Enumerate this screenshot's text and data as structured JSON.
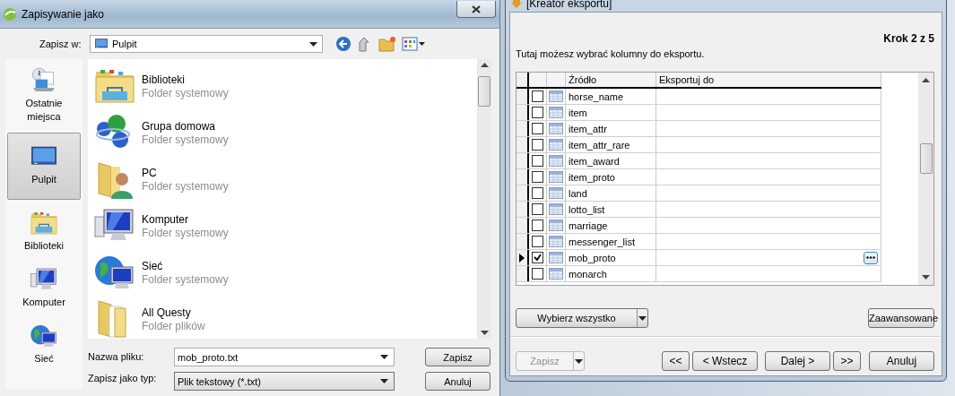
{
  "save_dialog": {
    "title": "Zapisywanie jako",
    "location_label": "Zapisz w:",
    "location": "Pulpit",
    "places": [
      {
        "label": "Ostatnie miejsca",
        "kind": "recent",
        "selected": false
      },
      {
        "label": "Pulpit",
        "kind": "desktop",
        "selected": true
      },
      {
        "label": "Biblioteki",
        "kind": "libraries",
        "selected": false
      },
      {
        "label": "Komputer",
        "kind": "computer",
        "selected": false
      },
      {
        "label": "Sieć",
        "kind": "network",
        "selected": false
      }
    ],
    "files": [
      {
        "name": "Biblioteki",
        "type": "Folder systemowy",
        "kind": "libraries"
      },
      {
        "name": "Grupa domowa",
        "type": "Folder systemowy",
        "kind": "homegroup"
      },
      {
        "name": "PC",
        "type": "Folder systemowy",
        "kind": "user"
      },
      {
        "name": "Komputer",
        "type": "Folder systemowy",
        "kind": "computer"
      },
      {
        "name": "Sieć",
        "type": "Folder systemowy",
        "kind": "network"
      },
      {
        "name": "All Questy",
        "type": "Folder plików",
        "kind": "folder"
      }
    ],
    "filename_label": "Nazwa pliku:",
    "filename": "mob_proto.txt",
    "filetype_label": "Zapisz jako typ:",
    "filetype": "Plik tekstowy (*.txt)",
    "buttons": [
      "Zapisz",
      "Anuluj"
    ]
  },
  "export_wizard": {
    "title": "[Kreator eksportu]",
    "step": "Krok 2 z 5",
    "description": "Tutaj możesz wybrać kolumny do eksportu.",
    "grid": {
      "columns": [
        "Źródło",
        "Eksportuj do"
      ],
      "rows": [
        {
          "source": "horse_name",
          "checked": false,
          "current": false
        },
        {
          "source": "item",
          "checked": false,
          "current": false
        },
        {
          "source": "item_attr",
          "checked": false,
          "current": false
        },
        {
          "source": "item_attr_rare",
          "checked": false,
          "current": false
        },
        {
          "source": "item_award",
          "checked": false,
          "current": false
        },
        {
          "source": "item_proto",
          "checked": false,
          "current": false
        },
        {
          "source": "land",
          "checked": false,
          "current": false
        },
        {
          "source": "lotto_list",
          "checked": false,
          "current": false
        },
        {
          "source": "marriage",
          "checked": false,
          "current": false
        },
        {
          "source": "messenger_list",
          "checked": false,
          "current": false
        },
        {
          "source": "mob_proto",
          "checked": true,
          "current": true
        },
        {
          "source": "monarch",
          "checked": false,
          "current": false
        }
      ]
    },
    "select_all": "Wybierz wszystko",
    "advanced": "Zaawansowane",
    "save_button": {
      "label": "Zapisz",
      "disabled": true
    },
    "nav_buttons": [
      "<<",
      "< Wstecz",
      "Dalej >",
      ">>"
    ],
    "cancel": "Anuluj"
  }
}
